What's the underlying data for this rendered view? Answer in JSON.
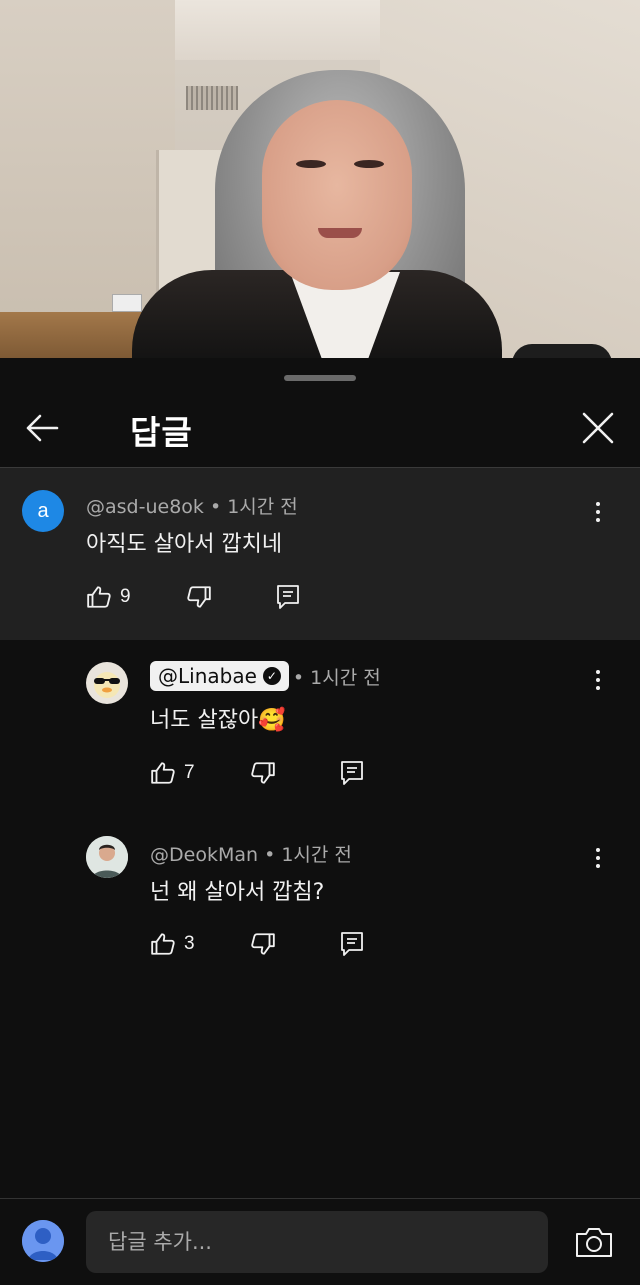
{
  "sheet": {
    "title": "답글"
  },
  "comments": [
    {
      "avatar_letter": "a",
      "author": "@asd-ue8ok",
      "time": " • 1시간 전",
      "text": "아직도 살아서 깝치네",
      "likes": "9"
    },
    {
      "author": "@Linabae",
      "time": " • 1시간 전",
      "text": "너도 살잖아🥰",
      "likes": "7",
      "verified": true
    },
    {
      "author": "@DeokMan",
      "time": " • 1시간 전",
      "text": "넌 왜 살아서 깝침?",
      "likes": "3"
    }
  ],
  "composer": {
    "placeholder": "답글 추가..."
  },
  "icons": [
    "back-arrow-icon",
    "close-icon",
    "like-icon",
    "dislike-icon",
    "reply-icon",
    "more-vert-icon",
    "camera-icon"
  ],
  "colors": {
    "background": "#0f0f0f",
    "parent_highlight": "#212121",
    "avatar_accent": "#1e88e5"
  }
}
